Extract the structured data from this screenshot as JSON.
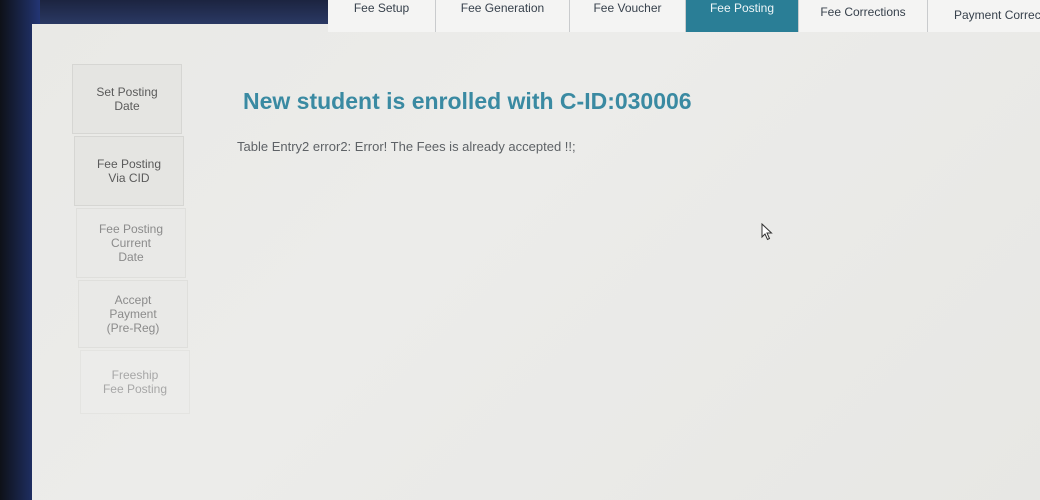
{
  "tabs": [
    {
      "label": "Fee Setup",
      "active": false
    },
    {
      "label": "Fee Generation",
      "active": false
    },
    {
      "label": "Fee Voucher",
      "active": false
    },
    {
      "label": "Fee Posting",
      "active": true
    },
    {
      "label": "Fee Corrections",
      "active": false
    },
    {
      "label": "Payment Correcti",
      "active": false
    }
  ],
  "sidebar": {
    "items": [
      {
        "line1": "Set Posting",
        "line2": "Date"
      },
      {
        "line1": "Fee Posting",
        "line2": "Via CID"
      },
      {
        "line1": "Fee Posting",
        "line2": "Current",
        "line3": "Date"
      },
      {
        "line1": "Accept",
        "line2": "Payment",
        "line3": "(Pre-Reg)"
      },
      {
        "line1": "Freeship",
        "line2": "Fee Posting"
      }
    ]
  },
  "main": {
    "heading": "New student is enrolled with C-ID:030006",
    "message": "Table Entry2 error2: Error! The Fees is already accepted !!;"
  },
  "colors": {
    "accent": "#2a7e96",
    "heading": "#3a8aa2"
  }
}
